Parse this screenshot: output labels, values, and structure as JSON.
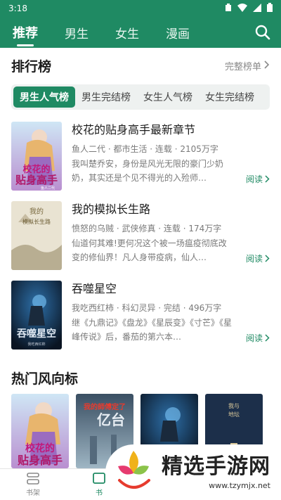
{
  "status": {
    "time": "3:18"
  },
  "topnav": {
    "tabs": [
      "推荐",
      "男生",
      "女生",
      "漫画"
    ]
  },
  "ranking": {
    "title": "排行榜",
    "more": "完整榜单",
    "tabs": [
      "男生人气榜",
      "男生完结榜",
      "女生人气榜",
      "女生完结榜"
    ],
    "books": [
      {
        "title": "校花的贴身高手最新章节",
        "meta": "鱼人二代 · 都市生活 · 连载 · 2105万字",
        "desc": "我叫楚乔安，身份是风光无限的豪门少奶奶，其实还是个见不得光的入殓师…",
        "read": "阅读",
        "cover_text": "校花的贴身高手",
        "cover_author": "鱼人二代"
      },
      {
        "title": "我的模拟长生路",
        "meta": "愤怒的乌贼 · 武侠修真 · 连载 · 174万字",
        "desc": "仙道何其难!更何况这个被一场瘟疫彻底改变的修仙界！凡人身带疫病，仙人…",
        "read": "阅读",
        "cover_text": "我的模拟长生路"
      },
      {
        "title": "吞噬星空",
        "meta": "我吃西红柿 · 科幻灵异 · 完结 · 496万字",
        "desc": "继《九鼎记》《盘龙》《星辰变》《寸芒》《星峰传说》后，番茄的第六本…",
        "read": "阅读",
        "cover_text": "吞噬星空",
        "cover_author": "我吃西红柿"
      }
    ]
  },
  "hot": {
    "title": "热门风向标",
    "covers": [
      {
        "text": "校花的贴身高手"
      },
      {
        "text": "我的師傅定了亿台"
      },
      {
        "text": "吞噬星空"
      },
      {
        "text": "我与地坛"
      }
    ]
  },
  "bottom": {
    "items": [
      "书架",
      "书"
    ]
  },
  "watermark": {
    "brand": "精选手游网",
    "url": "www.tzymjx.net"
  },
  "colors": {
    "primary": "#1f8a63"
  }
}
